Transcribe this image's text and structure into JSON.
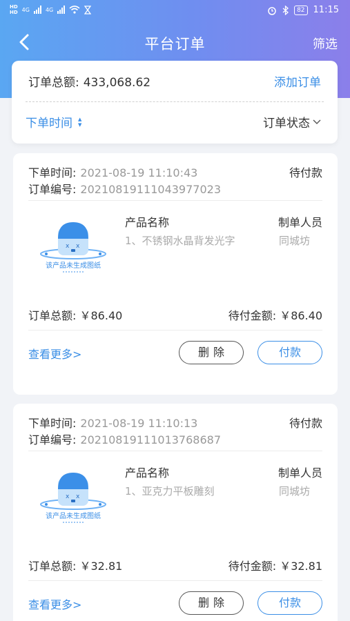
{
  "status_bar": {
    "sim1": "HD",
    "sim2": "HD",
    "net1": "4G",
    "net2": "4G",
    "battery": "82",
    "time": "11:15"
  },
  "nav": {
    "title": "平台订单",
    "filter_label": "筛选"
  },
  "summary": {
    "total_label": "订单总额:",
    "total_value": "433,068.62",
    "add_label": "添加订单",
    "sort_label": "下单时间",
    "status_label": "订单状态"
  },
  "orders": [
    {
      "time_label": "下单时间:",
      "time_value": "2021-08-19 11:10:43",
      "id_label": "订单编号:",
      "id_value": "20210819111043977023",
      "status": "待付款",
      "img_text": "该产品未生成图纸",
      "prod_header": "产品名称",
      "maker_header": "制单人员",
      "prod_name": "1、不锈钢水晶背发光字",
      "maker": "同城坊",
      "total_label": "订单总额:",
      "total_value": "￥86.40",
      "due_label": "待付金额:",
      "due_value": "￥86.40",
      "more": "查看更多>",
      "delete": "删除",
      "pay": "付款"
    },
    {
      "time_label": "下单时间:",
      "time_value": "2021-08-19 11:10:13",
      "id_label": "订单编号:",
      "id_value": "20210819111013768687",
      "status": "待付款",
      "img_text": "该产品未生成图纸",
      "prod_header": "产品名称",
      "maker_header": "制单人员",
      "prod_name": "1、亚克力平板雕刻",
      "maker": "同城坊",
      "total_label": "订单总额:",
      "total_value": "￥32.81",
      "due_label": "待付金额:",
      "due_value": "￥32.81",
      "more": "查看更多>",
      "delete": "删除",
      "pay": "付款"
    }
  ],
  "colors": {
    "accent": "#3a8ee6",
    "header_start": "#5aa7f2",
    "header_end": "#8b7fea"
  }
}
